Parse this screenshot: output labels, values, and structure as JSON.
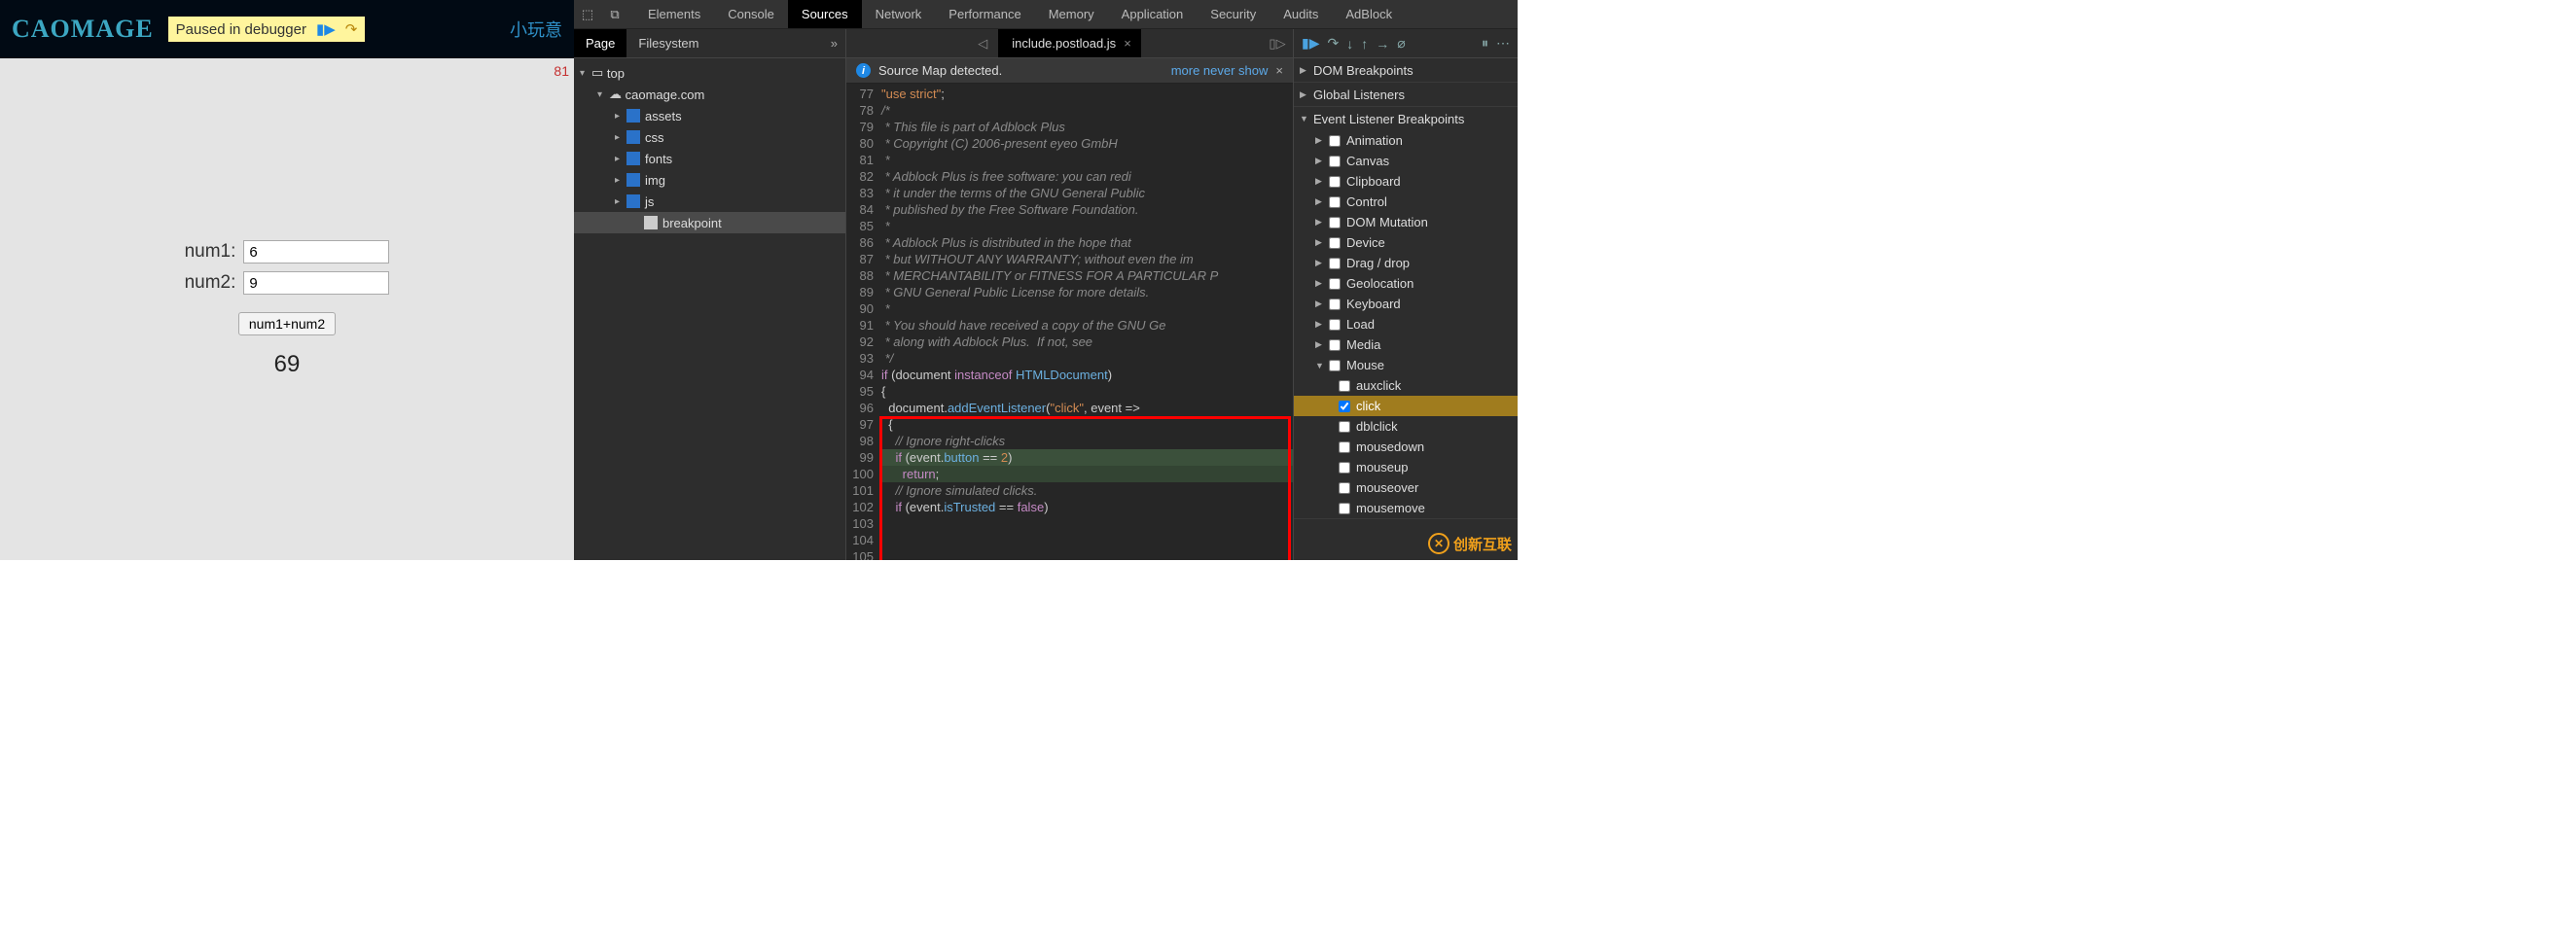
{
  "page": {
    "logo": "CAOMAGE",
    "paused_label": "Paused in debugger",
    "nav_link": "小玩意",
    "counter": "81",
    "num1_label": "num1:",
    "num1_value": "6",
    "num2_label": "num2:",
    "num2_value": "9",
    "add_label": "num1+num2",
    "result": "69"
  },
  "devtools": {
    "tabs": [
      "Elements",
      "Console",
      "Sources",
      "Network",
      "Performance",
      "Memory",
      "Application",
      "Security",
      "Audits",
      "AdBlock"
    ],
    "active_tab": "Sources",
    "nav_tabs": {
      "page": "Page",
      "filesystem": "Filesystem"
    },
    "tree": {
      "top": "top",
      "domain": "caomage.com",
      "folders": [
        "assets",
        "css",
        "fonts",
        "img",
        "js"
      ],
      "file": "breakpoint"
    },
    "open_file": "include.postload.js",
    "info_msg": "Source Map detected.",
    "info_link": "more never show",
    "code": {
      "first_line": 77,
      "lines": [
        "",
        "\"use strict\";",
        "/*",
        " * This file is part of Adblock Plus <https://ad",
        " * Copyright (C) 2006-present eyeo GmbH",
        " *",
        " * Adblock Plus is free software: you can redi",
        " * it under the terms of the GNU General Public",
        " * published by the Free Software Foundation.",
        " *",
        " * Adblock Plus is distributed in the hope that",
        " * but WITHOUT ANY WARRANTY; without even the im",
        " * MERCHANTABILITY or FITNESS FOR A PARTICULAR P",
        " * GNU General Public License for more details.",
        " *",
        " * You should have received a copy of the GNU Ge",
        " * along with Adblock Plus.  If not, see <http:/",
        " */",
        "",
        "",
        "",
        "if (document instanceof HTMLDocument)",
        "{",
        "  document.addEventListener(\"click\", event =>",
        "  {",
        "    // Ignore right-clicks",
        "    if (event.button == 2)",
        "      return;",
        "",
        "    // Ignore simulated clicks.",
        "    if (event.isTrusted == false)"
      ],
      "highlight_start": 97,
      "highlight_end": 107,
      "exec_line": 103,
      "pause_line": 104
    },
    "breakpoint_sections": {
      "dom": "DOM Breakpoints",
      "global": "Global Listeners",
      "event": "Event Listener Breakpoints"
    },
    "event_categories": [
      "Animation",
      "Canvas",
      "Clipboard",
      "Control",
      "DOM Mutation",
      "Device",
      "Drag / drop",
      "Geolocation",
      "Keyboard",
      "Load",
      "Media",
      "Mouse"
    ],
    "mouse_events": [
      "auxclick",
      "click",
      "dblclick",
      "mousedown",
      "mouseup",
      "mouseover",
      "mousemove"
    ],
    "mouse_checked": "click"
  },
  "watermark": "创新互联"
}
